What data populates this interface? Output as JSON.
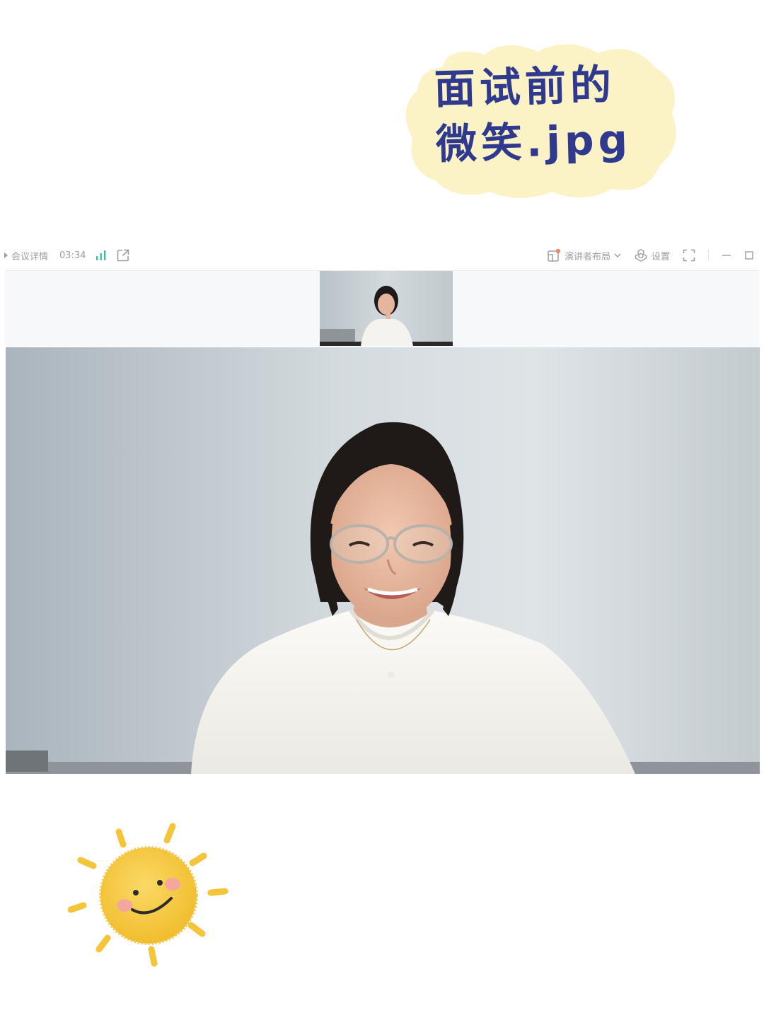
{
  "title": {
    "line1": "面试前的",
    "line2": "微笑.jpg"
  },
  "toolbar": {
    "meeting_details": "会议详情",
    "timer": "03:34",
    "layout_label": "演讲者布局",
    "settings_label": "设置"
  },
  "icons": {
    "expand": "triangle-right-icon",
    "signal": "signal-bars-icon",
    "share": "external-link-icon",
    "layout": "layout-icon",
    "dropdown": "chevron-down-icon",
    "settings": "gear-icon",
    "fullscreen": "fullscreen-icon",
    "minimize": "minimize-icon",
    "maximize": "maximize-icon",
    "sun": "smiling-sun-sticker"
  },
  "colors": {
    "title_text": "#2f3a8f",
    "cloud_fill": "#fbf3c6",
    "toolbar_text": "#9aa0a6",
    "signal": "#3cc39a",
    "notify_dot": "#f08a6c",
    "sun": "#f6c94a",
    "cheek": "#f4a79c"
  }
}
